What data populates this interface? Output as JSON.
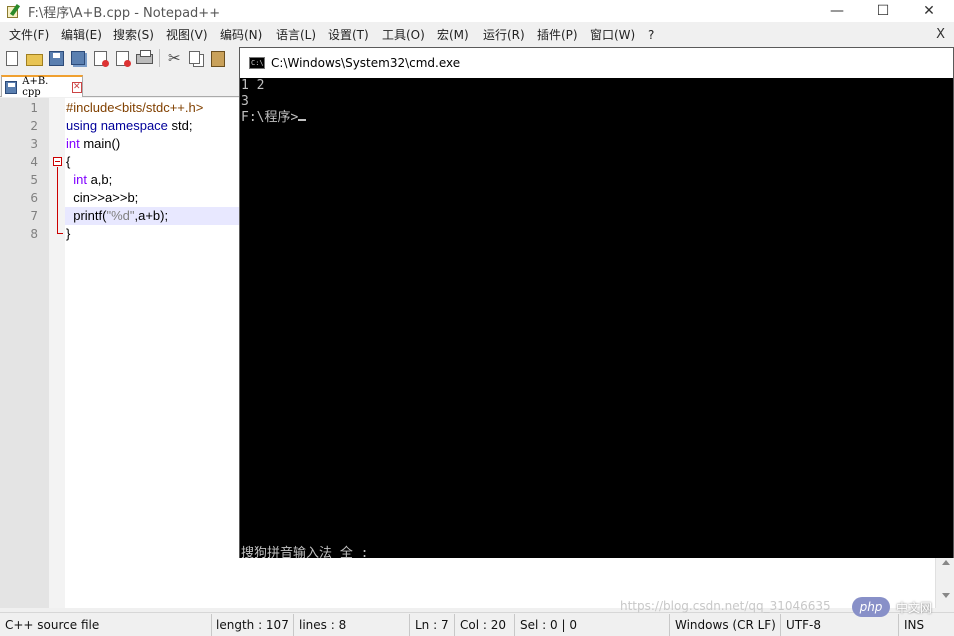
{
  "window": {
    "title": "F:\\程序\\A+B.cpp - Notepad++",
    "controls": {
      "minimize": "—",
      "maximize": "☐",
      "close": "✕"
    }
  },
  "menu": {
    "items": [
      "文件(F)",
      "编辑(E)",
      "搜索(S)",
      "视图(V)",
      "编码(N)",
      "语言(L)",
      "设置(T)",
      "工具(O)",
      "宏(M)",
      "运行(R)",
      "插件(P)",
      "窗口(W)",
      "?"
    ],
    "close_doc": "X"
  },
  "toolbar": {
    "icons": [
      "new-file-icon",
      "open-file-icon",
      "save-icon",
      "save-all-icon",
      "close-file-icon",
      "close-all-icon",
      "print-icon",
      "cut-icon",
      "copy-icon",
      "paste-icon"
    ]
  },
  "tab": {
    "name": "A+B. cpp"
  },
  "editor": {
    "line_numbers": [
      "1",
      "2",
      "3",
      "4",
      "5",
      "6",
      "7",
      "8"
    ],
    "current_line": 7,
    "lines": [
      [
        {
          "t": "#include<bits/stdc++.h>",
          "c": "pp"
        }
      ],
      [
        {
          "t": "using namespace",
          "c": "kw"
        },
        {
          "t": " std;",
          "c": ""
        }
      ],
      [
        {
          "t": "int",
          "c": "ty"
        },
        {
          "t": " main()",
          "c": ""
        }
      ],
      [
        {
          "t": "{",
          "c": ""
        }
      ],
      [
        {
          "t": "  int",
          "c": "ty"
        },
        {
          "t": " a,b;",
          "c": ""
        }
      ],
      [
        {
          "t": "  cin>>a>>b;",
          "c": ""
        }
      ],
      [
        {
          "t": "  printf(",
          "c": ""
        },
        {
          "t": "\"%d\"",
          "c": "st"
        },
        {
          "t": ",a+b);",
          "c": ""
        }
      ],
      [
        {
          "t": "}",
          "c": ""
        }
      ]
    ]
  },
  "console": {
    "icon_label": "C:\\",
    "title": "C:\\Windows\\System32\\cmd.exe",
    "lines": [
      "1 2",
      "3",
      "F:\\程序>"
    ],
    "ime_status": "搜狗拼音输入法 全 :"
  },
  "status": {
    "filetype": "C++ source file",
    "length": "length : 107",
    "lines": "lines : 8",
    "ln": "Ln : 7",
    "col": "Col : 20",
    "sel": "Sel : 0 | 0",
    "eol": "Windows (CR LF)",
    "encoding": "UTF-8",
    "mode": "INS"
  },
  "watermark": {
    "url": "https://blog.csdn.net/qq_31046635",
    "logo": "php",
    "logo_text": "中文网"
  }
}
